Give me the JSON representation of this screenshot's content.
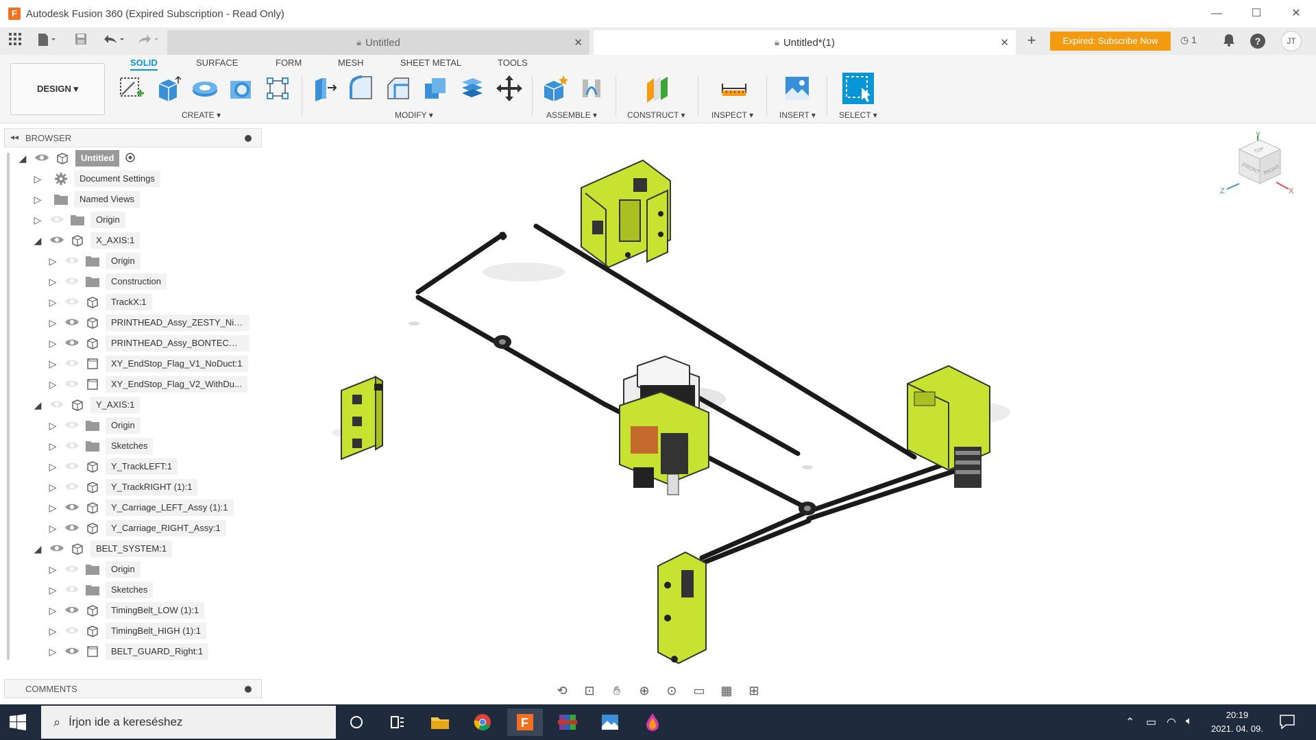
{
  "window": {
    "title": "Autodesk Fusion 360 (Expired Subscription - Read Only)",
    "logo_letter": "F",
    "minimize": "—",
    "maximize": "☐",
    "close": "✕"
  },
  "tabs": [
    {
      "label": "Untitled",
      "active": false
    },
    {
      "label": "Untitled*(1)",
      "active": true
    }
  ],
  "header": {
    "subscribe_label": "Expired: Subscribe Now",
    "job_count": "1",
    "help": "?",
    "user_initials": "JT"
  },
  "toolbar": {
    "workspace": "DESIGN",
    "workspace_tabs": [
      "SOLID",
      "SURFACE",
      "FORM",
      "MESH",
      "SHEET METAL",
      "TOOLS"
    ],
    "groups": [
      "CREATE",
      "MODIFY",
      "ASSEMBLE",
      "CONSTRUCT",
      "INSPECT",
      "INSERT",
      "SELECT"
    ]
  },
  "browser": {
    "title": "BROWSER",
    "items": [
      {
        "label": "Untitled",
        "level": 0,
        "expanded": true,
        "visible": true,
        "icon": "component"
      },
      {
        "label": "Document Settings",
        "level": 1,
        "expanded": false,
        "visible": null,
        "icon": "gear"
      },
      {
        "label": "Named Views",
        "level": 1,
        "expanded": false,
        "visible": null,
        "icon": "folder"
      },
      {
        "label": "Origin",
        "level": 1,
        "expanded": false,
        "visible": false,
        "icon": "folder"
      },
      {
        "label": "X_AXIS:1",
        "level": 1,
        "expanded": true,
        "visible": true,
        "icon": "component"
      },
      {
        "label": "Origin",
        "level": 2,
        "expanded": false,
        "visible": false,
        "icon": "folder"
      },
      {
        "label": "Construction",
        "level": 2,
        "expanded": false,
        "visible": false,
        "icon": "folder"
      },
      {
        "label": "TrackX:1",
        "level": 2,
        "expanded": false,
        "visible": false,
        "icon": "component"
      },
      {
        "label": "PRINTHEAD_Assy_ZESTY_Nim...",
        "level": 2,
        "expanded": false,
        "visible": true,
        "icon": "component"
      },
      {
        "label": "PRINTHEAD_Assy_BONTECH_I...",
        "level": 2,
        "expanded": false,
        "visible": true,
        "icon": "component"
      },
      {
        "label": "XY_EndStop_Flag_V1_NoDuct:1",
        "level": 2,
        "expanded": false,
        "visible": false,
        "icon": "body"
      },
      {
        "label": "XY_EndStop_Flag_V2_WithDu...",
        "level": 2,
        "expanded": false,
        "visible": false,
        "icon": "body"
      },
      {
        "label": "Y_AXIS:1",
        "level": 1,
        "expanded": true,
        "visible": false,
        "icon": "component"
      },
      {
        "label": "Origin",
        "level": 2,
        "expanded": false,
        "visible": false,
        "icon": "folder"
      },
      {
        "label": "Sketches",
        "level": 2,
        "expanded": false,
        "visible": false,
        "icon": "folder"
      },
      {
        "label": "Y_TrackLEFT:1",
        "level": 2,
        "expanded": false,
        "visible": false,
        "icon": "component"
      },
      {
        "label": "Y_TrackRIGHT (1):1",
        "level": 2,
        "expanded": false,
        "visible": false,
        "icon": "component"
      },
      {
        "label": "Y_Carriage_LEFT_Assy (1):1",
        "level": 2,
        "expanded": false,
        "visible": true,
        "icon": "component"
      },
      {
        "label": "Y_Carriage_RIGHT_Assy:1",
        "level": 2,
        "expanded": false,
        "visible": true,
        "icon": "component"
      },
      {
        "label": "BELT_SYSTEM:1",
        "level": 1,
        "expanded": true,
        "visible": true,
        "icon": "component"
      },
      {
        "label": "Origin",
        "level": 2,
        "expanded": false,
        "visible": false,
        "icon": "folder"
      },
      {
        "label": "Sketches",
        "level": 2,
        "expanded": false,
        "visible": false,
        "icon": "folder"
      },
      {
        "label": "TimingBelt_LOW (1):1",
        "level": 2,
        "expanded": false,
        "visible": true,
        "icon": "component"
      },
      {
        "label": "TimingBelt_HIGH (1):1",
        "level": 2,
        "expanded": false,
        "visible": false,
        "icon": "component"
      },
      {
        "label": "BELT_GUARD_Right:1",
        "level": 2,
        "expanded": false,
        "visible": true,
        "icon": "body"
      }
    ]
  },
  "comments": {
    "title": "COMMENTS"
  },
  "viewcube": {
    "top": "TOP",
    "front": "FRONT",
    "right": "RIGHT",
    "axis_x": "X",
    "axis_y": "Y",
    "axis_z": "Z"
  },
  "taskbar": {
    "search_placeholder": "Írjon ide a kereséshez",
    "time": "20:19",
    "date": "2021. 04. 09."
  },
  "colors": {
    "accent": "#0696d7",
    "subscribe": "#f39c12",
    "part_green": "#c8e232",
    "taskbar": "#1f2a3c"
  }
}
